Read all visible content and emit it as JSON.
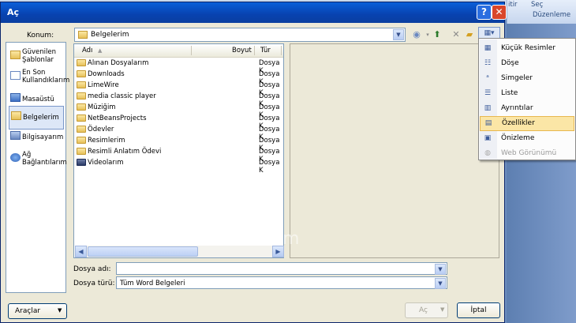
{
  "window": {
    "title": "Aç",
    "help": "?",
    "close": "✕"
  },
  "background_app": {
    "sec": "Seç",
    "sec_prefix": "itir",
    "duzenleme": "Düzenleme"
  },
  "location": {
    "label": "Konum:",
    "value": "Belgelerim"
  },
  "places": [
    {
      "label": "Güvenilen Şablonlar",
      "icon": "folder-icon"
    },
    {
      "label": "En Son Kullandıklarım",
      "icon": "recent-docs-icon"
    },
    {
      "label": "Masaüstü",
      "icon": "desktop-icon"
    },
    {
      "label": "Belgelerim",
      "icon": "my-documents-icon"
    },
    {
      "label": "Bilgisayarım",
      "icon": "computer-icon"
    },
    {
      "label": "Ağ Bağlantılarım",
      "icon": "network-icon"
    }
  ],
  "columns": {
    "name": "Adı",
    "size": "Boyut",
    "type": "Tür"
  },
  "files": [
    {
      "name": "Alınan Dosyalarım",
      "type": "Dosya K"
    },
    {
      "name": "Downloads",
      "type": "Dosya K"
    },
    {
      "name": "LimeWire",
      "type": "Dosya K"
    },
    {
      "name": "media classic player",
      "type": "Dosya K"
    },
    {
      "name": "Müziğim",
      "type": "Dosya K"
    },
    {
      "name": "NetBeansProjects",
      "type": "Dosya K"
    },
    {
      "name": "Ödevler",
      "type": "Dosya K"
    },
    {
      "name": "Resimlerim",
      "type": "Dosya K"
    },
    {
      "name": "Resimli Anlatım Ödevi",
      "type": "Dosya K"
    },
    {
      "name": "Videolarım",
      "type": "Dosya K"
    }
  ],
  "filename": {
    "label": "Dosya adı:",
    "value": ""
  },
  "filetype": {
    "label": "Dosya türü:",
    "value": "Tüm Word Belgeleri"
  },
  "buttons": {
    "tools": "Araçlar",
    "open": "Aç",
    "cancel": "İptal"
  },
  "views_menu": [
    {
      "label": "Küçük Resimler",
      "icon": "thumbnails-icon"
    },
    {
      "label": "Döşe",
      "icon": "tiles-icon"
    },
    {
      "label": "Simgeler",
      "icon": "icons-view-icon"
    },
    {
      "label": "Liste",
      "icon": "list-view-icon"
    },
    {
      "label": "Ayrıntılar",
      "icon": "details-view-icon"
    },
    {
      "label": "Özellikler",
      "icon": "properties-view-icon",
      "highlighted": true
    },
    {
      "label": "Önizleme",
      "icon": "preview-view-icon"
    },
    {
      "label": "Web Görünümü",
      "icon": "web-view-icon",
      "disabled": true
    }
  ],
  "watermark": "teknofilii.com"
}
